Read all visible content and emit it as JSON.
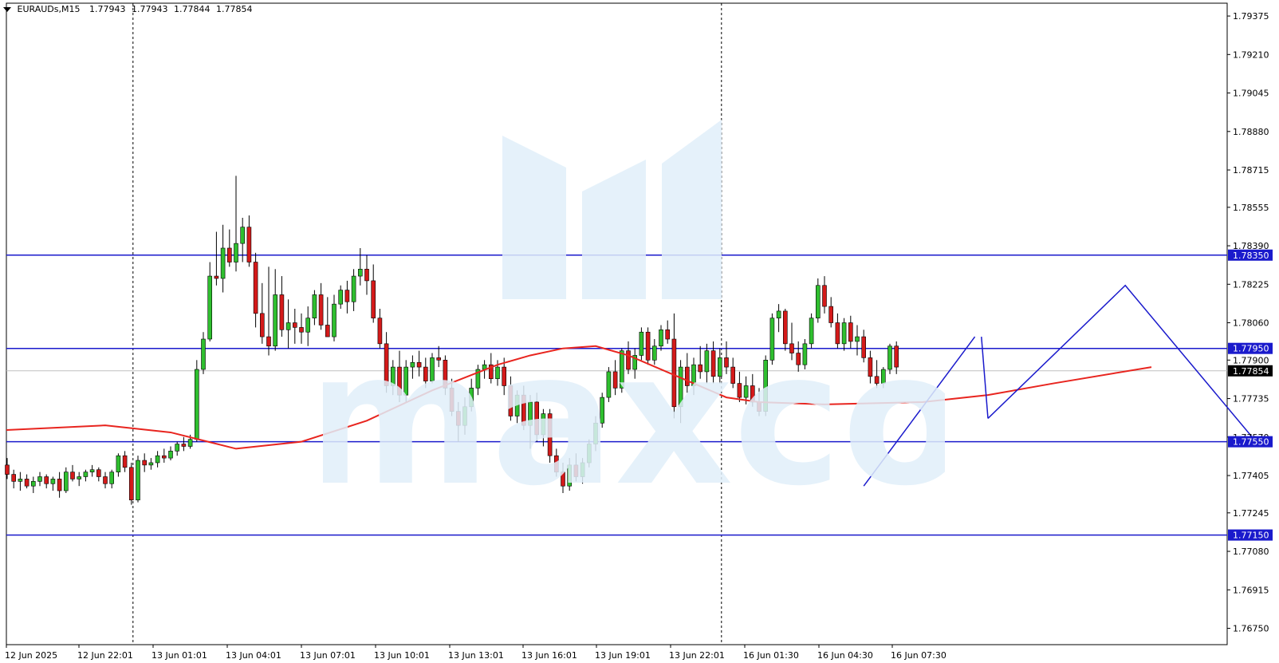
{
  "header": {
    "symbol_label": "EURAUDs,M15",
    "ohlc": [
      "1.77943",
      "1.77943",
      "1.77844",
      "1.77854"
    ]
  },
  "watermark_text": "maxco",
  "chart_data": {
    "type": "candlestick",
    "title": "EURAUDs,M15",
    "y_ticks": [
      "1.79375",
      "1.79210",
      "1.79045",
      "1.78880",
      "1.78715",
      "1.78555",
      "1.78390",
      "1.78225",
      "1.78060",
      "1.77900",
      "1.77735",
      "1.77570",
      "1.77405",
      "1.77245",
      "1.77080",
      "1.76915",
      "1.76750"
    ],
    "ylim": [
      1.7668,
      1.7943
    ],
    "x_labels": [
      "12 Jun 2025",
      "12 Jun 22:01",
      "13 Jun 01:01",
      "13 Jun 04:01",
      "13 Jun 07:01",
      "13 Jun 10:01",
      "13 Jun 13:01",
      "13 Jun 16:01",
      "13 Jun 19:01",
      "13 Jun 22:01",
      "16 Jun 01:30",
      "16 Jun 04:30",
      "16 Jun 07:30"
    ],
    "levels": [
      {
        "value": 1.7835,
        "label": "1.78350"
      },
      {
        "value": 1.7795,
        "label": "1.77950"
      },
      {
        "value": 1.7755,
        "label": "1.77550"
      },
      {
        "value": 1.7715,
        "label": "1.77150"
      }
    ],
    "current_price": {
      "value": 1.77854,
      "label": "1.77854"
    },
    "moving_average": {
      "color": "#e8251f",
      "points": [
        [
          0,
          1.776
        ],
        [
          15,
          1.7762
        ],
        [
          25,
          1.7759
        ],
        [
          35,
          1.7752
        ],
        [
          45,
          1.7755
        ],
        [
          55,
          1.7764
        ],
        [
          65,
          1.7777
        ],
        [
          75,
          1.7788
        ],
        [
          80,
          1.7792
        ],
        [
          85,
          1.7795
        ],
        [
          90,
          1.7796
        ],
        [
          95,
          1.7792
        ],
        [
          105,
          1.778
        ],
        [
          110,
          1.7774
        ],
        [
          115,
          1.7772
        ],
        [
          125,
          1.7771
        ],
        [
          140,
          1.7772
        ],
        [
          150,
          1.7775
        ],
        [
          160,
          1.778
        ],
        [
          175,
          1.7787
        ]
      ]
    },
    "candles": [
      [
        1.7745,
        1.7748,
        1.7739,
        1.7741
      ],
      [
        1.7741,
        1.7743,
        1.7735,
        1.7738
      ],
      [
        1.7738,
        1.7742,
        1.7734,
        1.7739
      ],
      [
        1.7739,
        1.7741,
        1.7735,
        1.7736
      ],
      [
        1.7736,
        1.774,
        1.7733,
        1.7738
      ],
      [
        1.7738,
        1.7742,
        1.7736,
        1.774
      ],
      [
        1.774,
        1.7741,
        1.7735,
        1.7737
      ],
      [
        1.7737,
        1.774,
        1.7734,
        1.7739
      ],
      [
        1.7739,
        1.7742,
        1.7731,
        1.7734
      ],
      [
        1.7734,
        1.7744,
        1.7733,
        1.7742
      ],
      [
        1.7742,
        1.7745,
        1.7738,
        1.7739
      ],
      [
        1.7739,
        1.7742,
        1.7736,
        1.774
      ],
      [
        1.774,
        1.7743,
        1.7738,
        1.7742
      ],
      [
        1.7742,
        1.7745,
        1.774,
        1.7743
      ],
      [
        1.7743,
        1.7744,
        1.7738,
        1.774
      ],
      [
        1.774,
        1.7742,
        1.7735,
        1.7737
      ],
      [
        1.7737,
        1.7743,
        1.7735,
        1.7742
      ],
      [
        1.7742,
        1.775,
        1.774,
        1.7749
      ],
      [
        1.7749,
        1.7751,
        1.7742,
        1.7744
      ],
      [
        1.7744,
        1.7746,
        1.7728,
        1.773
      ],
      [
        1.773,
        1.7749,
        1.7729,
        1.7747
      ],
      [
        1.7747,
        1.775,
        1.7742,
        1.7745
      ],
      [
        1.7745,
        1.7748,
        1.7743,
        1.7746
      ],
      [
        1.7746,
        1.7751,
        1.7744,
        1.7749
      ],
      [
        1.7749,
        1.7752,
        1.7746,
        1.7748
      ],
      [
        1.7748,
        1.7753,
        1.7747,
        1.7751
      ],
      [
        1.7751,
        1.7755,
        1.7749,
        1.7754
      ],
      [
        1.7754,
        1.7757,
        1.7751,
        1.7753
      ],
      [
        1.7753,
        1.7758,
        1.7752,
        1.7756
      ],
      [
        1.7756,
        1.779,
        1.7755,
        1.7786
      ],
      [
        1.7786,
        1.7802,
        1.7784,
        1.7799
      ],
      [
        1.7799,
        1.7832,
        1.7798,
        1.7826
      ],
      [
        1.7826,
        1.7845,
        1.7822,
        1.7825
      ],
      [
        1.7825,
        1.7848,
        1.7819,
        1.7838
      ],
      [
        1.7838,
        1.7846,
        1.783,
        1.7832
      ],
      [
        1.7832,
        1.7869,
        1.7828,
        1.784
      ],
      [
        1.784,
        1.7851,
        1.7832,
        1.7847
      ],
      [
        1.7847,
        1.7852,
        1.783,
        1.7832
      ],
      [
        1.7832,
        1.7836,
        1.7804,
        1.781
      ],
      [
        1.781,
        1.7823,
        1.7797,
        1.78
      ],
      [
        1.78,
        1.783,
        1.7792,
        1.7796
      ],
      [
        1.7796,
        1.7829,
        1.7794,
        1.7818
      ],
      [
        1.7818,
        1.7826,
        1.78,
        1.7803
      ],
      [
        1.7803,
        1.7816,
        1.7795,
        1.7806
      ],
      [
        1.7806,
        1.7812,
        1.7797,
        1.7804
      ],
      [
        1.7804,
        1.781,
        1.7797,
        1.7802
      ],
      [
        1.7802,
        1.7813,
        1.7796,
        1.7808
      ],
      [
        1.7808,
        1.782,
        1.7805,
        1.7818
      ],
      [
        1.7818,
        1.7823,
        1.7803,
        1.7805
      ],
      [
        1.7805,
        1.7817,
        1.78,
        1.78
      ],
      [
        1.78,
        1.7818,
        1.7798,
        1.7814
      ],
      [
        1.7814,
        1.7822,
        1.7812,
        1.782
      ],
      [
        1.782,
        1.7824,
        1.781,
        1.7815
      ],
      [
        1.7815,
        1.7829,
        1.7811,
        1.7826
      ],
      [
        1.7826,
        1.7838,
        1.7822,
        1.7829
      ],
      [
        1.7829,
        1.7835,
        1.7818,
        1.7824
      ],
      [
        1.7824,
        1.7831,
        1.7806,
        1.7808
      ],
      [
        1.7808,
        1.7812,
        1.7795,
        1.7797
      ],
      [
        1.7797,
        1.7802,
        1.7776,
        1.7779
      ],
      [
        1.7779,
        1.779,
        1.7775,
        1.7787
      ],
      [
        1.7787,
        1.7794,
        1.7772,
        1.7775
      ],
      [
        1.7775,
        1.779,
        1.7772,
        1.7787
      ],
      [
        1.7787,
        1.7792,
        1.7782,
        1.7789
      ],
      [
        1.7789,
        1.7794,
        1.7783,
        1.7787
      ],
      [
        1.7787,
        1.7791,
        1.7778,
        1.7781
      ],
      [
        1.7781,
        1.7793,
        1.778,
        1.7791
      ],
      [
        1.7791,
        1.7796,
        1.7787,
        1.779
      ],
      [
        1.779,
        1.7792,
        1.7775,
        1.7778
      ],
      [
        1.7778,
        1.7782,
        1.7766,
        1.7768
      ],
      [
        1.7768,
        1.7772,
        1.7755,
        1.7762
      ],
      [
        1.7762,
        1.7774,
        1.7758,
        1.777
      ],
      [
        1.777,
        1.7782,
        1.7768,
        1.7778
      ],
      [
        1.7778,
        1.7788,
        1.7775,
        1.7786
      ],
      [
        1.7786,
        1.779,
        1.7782,
        1.7788
      ],
      [
        1.7788,
        1.7793,
        1.778,
        1.7782
      ],
      [
        1.7782,
        1.779,
        1.7779,
        1.7787
      ],
      [
        1.7787,
        1.7791,
        1.7775,
        1.7779
      ],
      [
        1.7779,
        1.7783,
        1.7764,
        1.7766
      ],
      [
        1.7766,
        1.7777,
        1.7763,
        1.7775
      ],
      [
        1.7775,
        1.7779,
        1.776,
        1.7762
      ],
      [
        1.7762,
        1.7775,
        1.7752,
        1.7772
      ],
      [
        1.7772,
        1.7776,
        1.7755,
        1.7758
      ],
      [
        1.7758,
        1.7769,
        1.7753,
        1.7767
      ],
      [
        1.7767,
        1.7769,
        1.7746,
        1.7749
      ],
      [
        1.7749,
        1.7752,
        1.774,
        1.7742
      ],
      [
        1.7742,
        1.7746,
        1.7733,
        1.7736
      ],
      [
        1.7736,
        1.7748,
        1.7734,
        1.7745
      ],
      [
        1.7745,
        1.775,
        1.7738,
        1.774
      ],
      [
        1.774,
        1.7748,
        1.7737,
        1.7746
      ],
      [
        1.7746,
        1.7756,
        1.7744,
        1.7754
      ],
      [
        1.7754,
        1.7766,
        1.7751,
        1.7763
      ],
      [
        1.7763,
        1.7776,
        1.7761,
        1.7774
      ],
      [
        1.7774,
        1.7787,
        1.7772,
        1.7785
      ],
      [
        1.7785,
        1.779,
        1.7775,
        1.7778
      ],
      [
        1.7778,
        1.7795,
        1.7776,
        1.7794
      ],
      [
        1.7794,
        1.7798,
        1.7784,
        1.7786
      ],
      [
        1.7786,
        1.7795,
        1.7782,
        1.7792
      ],
      [
        1.7792,
        1.7804,
        1.779,
        1.7802
      ],
      [
        1.7802,
        1.7804,
        1.7788,
        1.779
      ],
      [
        1.779,
        1.7799,
        1.7788,
        1.7796
      ],
      [
        1.7796,
        1.7805,
        1.7794,
        1.7803
      ],
      [
        1.7803,
        1.7807,
        1.7797,
        1.7799
      ],
      [
        1.7799,
        1.781,
        1.7765,
        1.777
      ],
      [
        1.777,
        1.779,
        1.7763,
        1.7787
      ],
      [
        1.7787,
        1.7793,
        1.7776,
        1.7779
      ],
      [
        1.7779,
        1.7791,
        1.7775,
        1.7788
      ],
      [
        1.7788,
        1.7796,
        1.7782,
        1.7785
      ],
      [
        1.7785,
        1.7797,
        1.778,
        1.7794
      ],
      [
        1.7794,
        1.7798,
        1.778,
        1.7783
      ],
      [
        1.7783,
        1.7795,
        1.778,
        1.7791
      ],
      [
        1.7791,
        1.7798,
        1.7784,
        1.7787
      ],
      [
        1.7787,
        1.7791,
        1.7778,
        1.778
      ],
      [
        1.778,
        1.7785,
        1.7772,
        1.7774
      ],
      [
        1.7774,
        1.7783,
        1.7771,
        1.7779
      ],
      [
        1.7779,
        1.7784,
        1.777,
        1.7772
      ],
      [
        1.7772,
        1.7778,
        1.7766,
        1.7768
      ],
      [
        1.7768,
        1.7792,
        1.7766,
        1.779
      ],
      [
        1.779,
        1.781,
        1.7788,
        1.7808
      ],
      [
        1.7808,
        1.7814,
        1.7802,
        1.7811
      ],
      [
        1.7811,
        1.7812,
        1.7794,
        1.7797
      ],
      [
        1.7797,
        1.7806,
        1.779,
        1.7793
      ],
      [
        1.7793,
        1.7798,
        1.7785,
        1.7788
      ],
      [
        1.7788,
        1.7799,
        1.7786,
        1.7797
      ],
      [
        1.7797,
        1.781,
        1.7795,
        1.7808
      ],
      [
        1.7808,
        1.7825,
        1.7806,
        1.7822
      ],
      [
        1.7822,
        1.7826,
        1.781,
        1.7813
      ],
      [
        1.7813,
        1.7817,
        1.7804,
        1.7806
      ],
      [
        1.7806,
        1.781,
        1.7795,
        1.7797
      ],
      [
        1.7797,
        1.7808,
        1.7794,
        1.7806
      ],
      [
        1.7806,
        1.7809,
        1.7795,
        1.7798
      ],
      [
        1.7798,
        1.7805,
        1.7792,
        1.78
      ],
      [
        1.78,
        1.7803,
        1.7789,
        1.7791
      ],
      [
        1.7791,
        1.7794,
        1.778,
        1.7783
      ],
      [
        1.7783,
        1.779,
        1.7778,
        1.778
      ],
      [
        1.778,
        1.7787,
        1.7778,
        1.7786
      ],
      [
        1.7786,
        1.7797,
        1.7784,
        1.7796
      ],
      [
        1.7796,
        1.7798,
        1.7784,
        1.7787
      ]
    ],
    "annotations": [
      {
        "type": "trendline",
        "points": [
          [
            131,
            1.7736
          ],
          [
            148,
            1.78
          ]
        ]
      },
      {
        "type": "polyline",
        "points": [
          [
            149,
            1.78
          ],
          [
            150,
            1.7765
          ]
        ]
      },
      {
        "type": "polyline",
        "points": [
          [
            150,
            1.7765
          ],
          [
            171,
            1.7822
          ],
          [
            191,
            1.7755
          ]
        ]
      }
    ],
    "vertical_markers": [
      19,
      109
    ]
  }
}
